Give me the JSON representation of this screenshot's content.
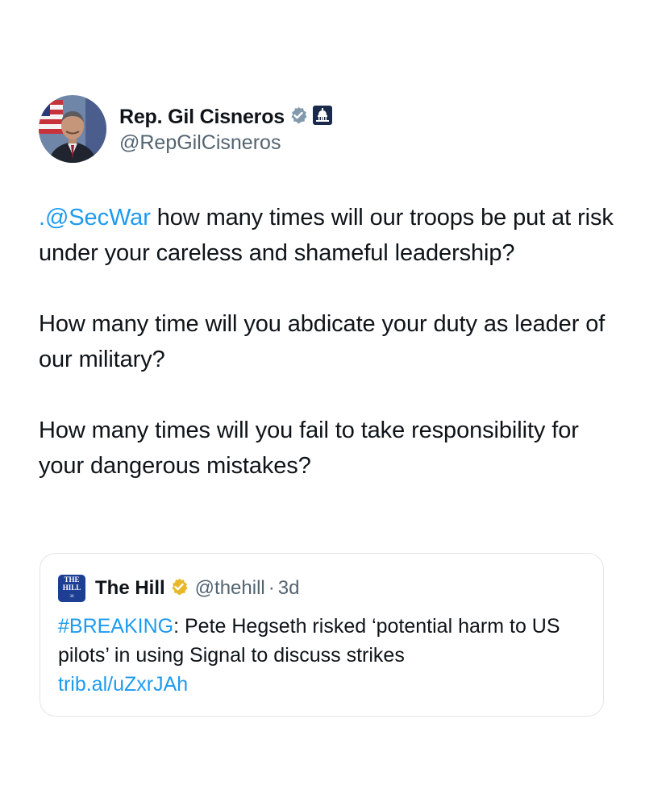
{
  "author": {
    "display_name": "Rep. Gil Cisneros",
    "handle": "@RepGilCisneros",
    "avatar_icon": "profile-photo",
    "badges": [
      "verified-badge-icon",
      "government-capitol-icon"
    ],
    "verified_color": "#829aab"
  },
  "tweet": {
    "mention": ".@SecWar",
    "line1_rest": " how many times will our troops be put at risk under your careless and shameful leadership?",
    "paragraph2": "How many time will you abdicate your duty as leader of our military?",
    "paragraph3": "How many times will you fail to take responsibility for your dangerous mistakes?"
  },
  "quote": {
    "logo": {
      "line1": "THE",
      "line2": "HILL",
      "line3": "30"
    },
    "display_name": "The Hill",
    "handle": "@thehill",
    "separator": "·",
    "time": "3d",
    "hashtag": "#BREAKING",
    "text": ": Pete Hegseth risked ‘potential harm to US pilots’ in using Signal to discuss strikes",
    "link": "trib.al/uZxrJAh",
    "verified_color": "#e8b829"
  },
  "colors": {
    "link": "#1d9bf0",
    "secondary": "#536471",
    "text": "#0f1419"
  }
}
